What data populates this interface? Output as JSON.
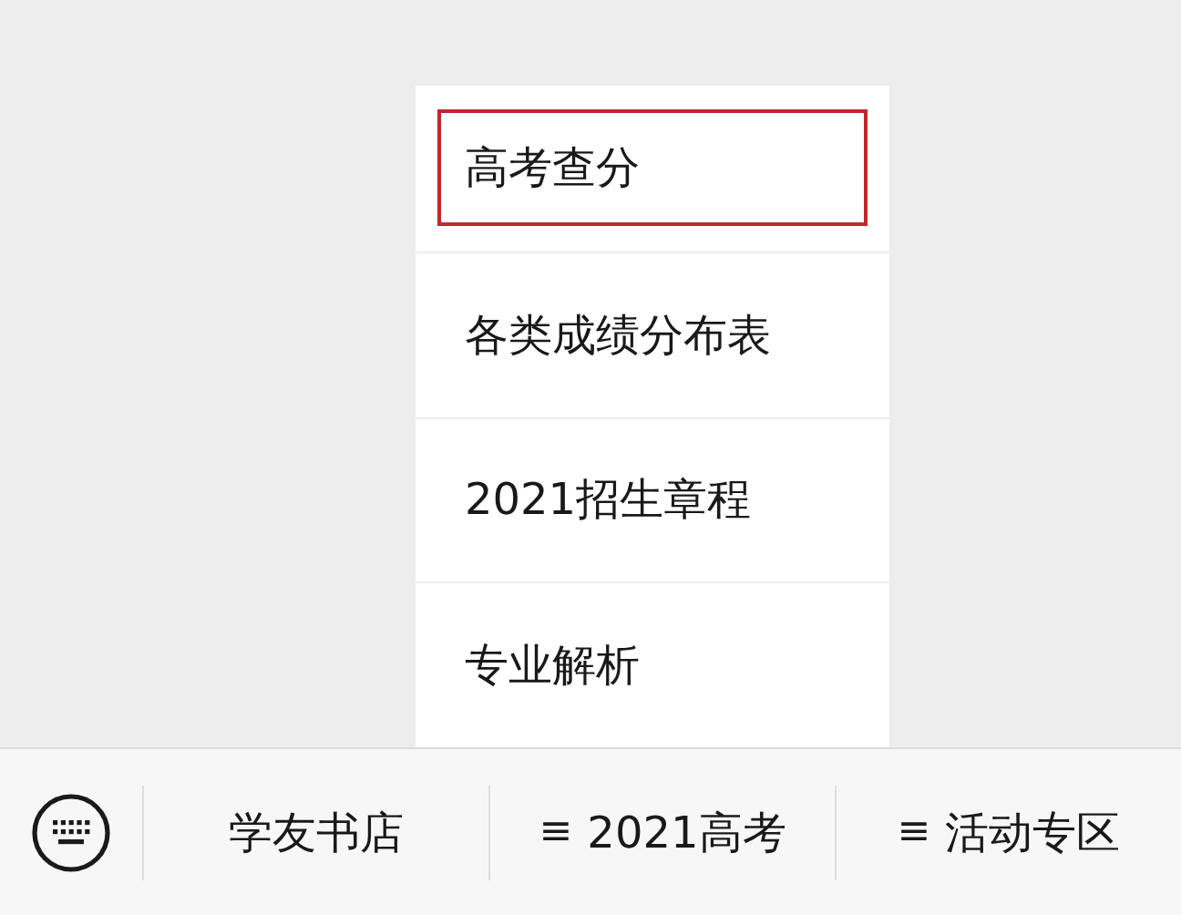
{
  "popup_menu": {
    "items": [
      {
        "label": "高考查分",
        "selected": true
      },
      {
        "label": "各类成绩分布表",
        "selected": false
      },
      {
        "label": "2021招生章程",
        "selected": false
      },
      {
        "label": "专业解析",
        "selected": false
      }
    ]
  },
  "bottom_bar": {
    "menus": [
      {
        "label": "学友书店"
      },
      {
        "prefix": "≡",
        "label": "2021高考"
      },
      {
        "prefix": "≡",
        "label": "活动专区"
      }
    ]
  }
}
